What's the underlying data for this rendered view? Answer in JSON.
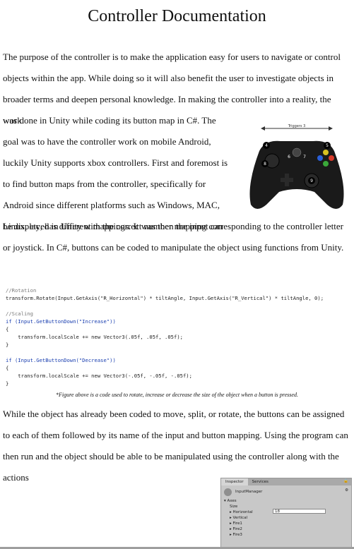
{
  "doc": {
    "title": "Controller Documentation",
    "para1_full": "The purpose of the controller is to make the application easy for users to navigate or control objects within the app. While doing so it will also benefit the user to investigate objects in broader terms and deepen personal knowledge. In making the controller into a reality, the work",
    "para1_wrap": "was done in Unity while coding its button map in C#. The goal was to have the controller work on mobile Android, luckily Unity supports xbox controllers. First and foremost is to find button maps from the controller, specifically for Android since different platforms such as Windows, MAC, Linux, etc, has different mappings. It was then the input can",
    "para1_tail": "be displayed in Unity with the correct number mapping corresponding to the controller letter or joystick. In C#, buttons can be coded to manipulate the object using functions from Unity.",
    "caption": "*Figure above is a code used to rotate, increase or decrease the size of the object when a button is pressed.",
    "para2": "While the object has already been coded to move, split, or rotate, the buttons can be assigned to each of them followed by its name of the input and button mapping. Using the program can then run and the object should be able to be manipulated using the controller along with the actions"
  },
  "controller_image": {
    "label": "Triggers 3",
    "buttons": [
      "4",
      "5",
      "8",
      "6",
      "7",
      "9",
      "Y",
      "X",
      "B",
      "A"
    ],
    "icon": "xbox-controller-icon"
  },
  "code": {
    "lines": [
      "//Rotation",
      "transform.Rotate(Input.GetAxis(\"R_Horizontal\") * tiltAngle, Input.GetAxis(\"R_Vertical\") * tiltAngle, 0);",
      "",
      "//Scaling",
      "if (Input.GetButtonDown(\"Increase\"))",
      "{",
      "    transform.localScale += new Vector3(.05f, .05f, .05f);",
      "}",
      "",
      "if (Input.GetButtonDown(\"Decrease\"))",
      "{",
      "    transform.localScale += new Vector3(-.05f, -.05f, -.05f);",
      "}"
    ]
  },
  "inspector": {
    "tab_inspector": "Inspector",
    "tab_services": "Services",
    "object_name": "InputManager",
    "section": "Axes",
    "size_label": "Size",
    "size_value": "18",
    "items": [
      "Horizontal",
      "Vertical",
      "Fire1",
      "Fire2",
      "Fire3"
    ]
  }
}
